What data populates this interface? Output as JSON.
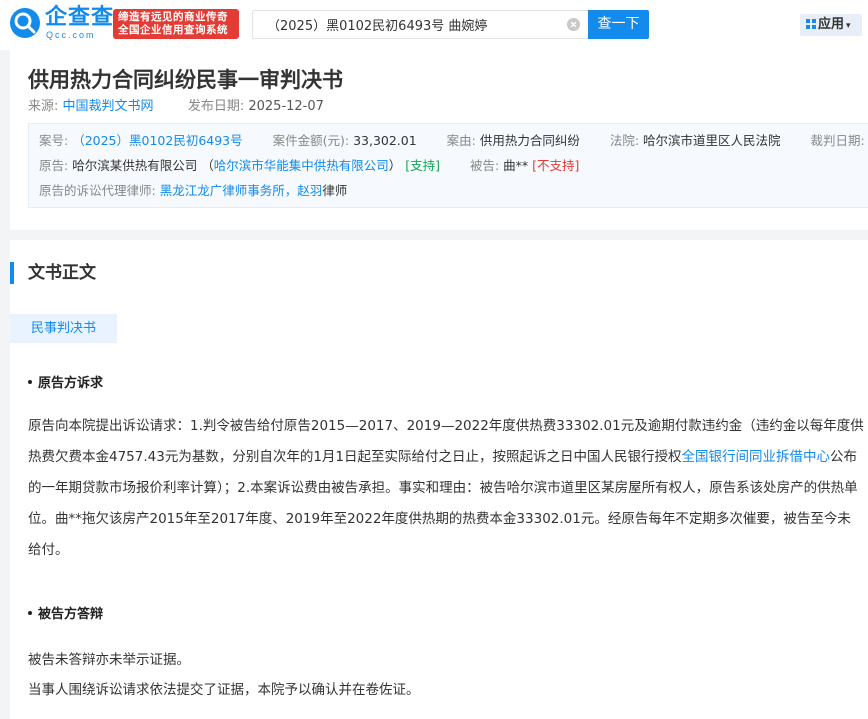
{
  "header": {
    "logo_text": "企查查",
    "logo_sub": "Qcc.com",
    "slogan_line1": "缔造有远见的商业传奇",
    "slogan_line2": "全国企业信用查询系统",
    "search_value": "（2025）黑0102民初6493号 曲婉婷",
    "search_button": "查一下",
    "app_menu": "应用"
  },
  "document": {
    "title": "供用热力合同纠纷民事一审判决书",
    "source_label": "来源:",
    "source_value": "中国裁判文书网",
    "publish_label": "发布日期:",
    "publish_value": "2025-12-07"
  },
  "info": {
    "case_no_label": "案号:",
    "case_no_value": "（2025）黑0102民初6493号",
    "amount_label": "案件金额(元):",
    "amount_value": "33,302.01",
    "cause_label": "案由:",
    "cause_value": "供用热力合同纠纷",
    "court_label": "法院:",
    "court_value": "哈尔滨市道里区人民法院",
    "judge_date_label": "裁判日期:",
    "plaintiff_label": "原告:",
    "plaintiff_value": "哈尔滨某供热有限公司",
    "plaintiff_alias_open": "（",
    "plaintiff_alias": "哈尔滨市华能集中供热有限公司",
    "plaintiff_alias_close": "）",
    "plaintiff_status": "[支持]",
    "defendant_label": "被告:",
    "defendant_value": "曲**",
    "defendant_status": "[不支持]",
    "lawyer_label": "原告的诉讼代理律师:",
    "law_firm": "黑龙江龙广律师事务所",
    "lawyer_sep": "，",
    "lawyer_name": "赵羽",
    "lawyer_suffix": "律师"
  },
  "body": {
    "section_title": "文书正文",
    "tab_label": "民事判决书",
    "claim_heading": "原告方诉求",
    "claim_part1": "原告向本院提出诉讼请求：1.判令被告给付原告2015—2017、2019—2022年度供热费33302.01元及逾期付款违约金（违约金以每年度供热费欠费本金4757.43元为基数，分别自次年的1月1日起至实际给付之日止，按照起诉之日中国人民银行授权",
    "claim_link": "全国银行间同业拆借中心",
    "claim_part2": "公布的一年期贷款市场报价利率计算）；2.本案诉讼费由被告承担。事实和理由：被告哈尔滨市道里区某房屋所有权人，原告系该处房产的供热单位。曲**拖欠该房产2015年至2017年度、2019年至2022年度供热期的热费本金33302.01元。经原告每年不定期多次催要，被告至今未给付。",
    "defense_heading": "被告方答辩",
    "defense_line1": "被告未答辩亦未举示证据。",
    "defense_line2": "当事人围绕诉讼请求依法提交了证据，本院予以确认并在卷佐证。"
  }
}
